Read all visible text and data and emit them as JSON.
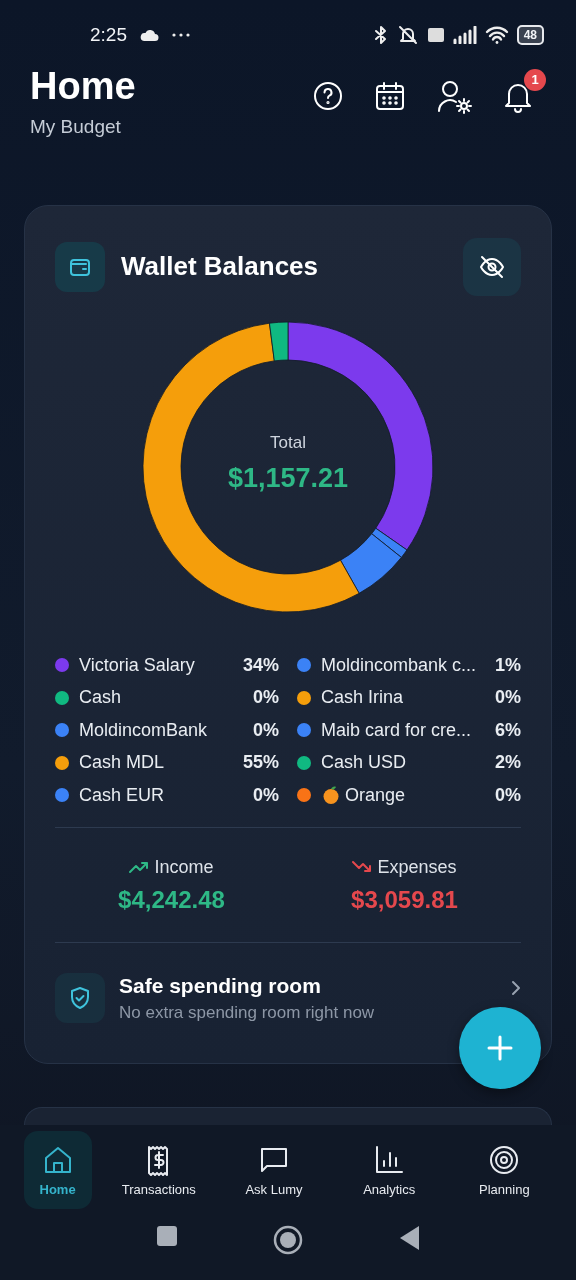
{
  "status_bar": {
    "time": "2:25",
    "battery": "48"
  },
  "header": {
    "title": "Home",
    "subtitle": "My Budget",
    "notification_count": "1"
  },
  "wallet_card": {
    "title": "Wallet Balances",
    "total_label": "Total",
    "total_value": "$1,157.21",
    "chart_data": {
      "type": "donut",
      "categories": [
        "Victoria Salary",
        "Moldincombank c...",
        "Cash",
        "Cash Irina",
        "MoldincomBank",
        "Maib card for cre...",
        "Cash MDL",
        "Cash USD",
        "Cash EUR",
        "Orange"
      ],
      "values": [
        34,
        1,
        0,
        0,
        0,
        6,
        55,
        2,
        0,
        0
      ],
      "value_labels": [
        "34%",
        "1%",
        "0%",
        "0%",
        "0%",
        "6%",
        "55%",
        "2%",
        "0%",
        "0%"
      ],
      "legend": "bottom"
    },
    "legend": [
      {
        "color": "#7c3aed",
        "fruit_icon": false
      },
      {
        "color": "#3b82f6",
        "fruit_icon": false
      },
      {
        "color": "#10b981",
        "fruit_icon": false
      },
      {
        "color": "#f59e0b",
        "fruit_icon": false
      },
      {
        "color": "#3b82f6",
        "fruit_icon": false
      },
      {
        "color": "#3b82f6",
        "fruit_icon": false
      },
      {
        "color": "#f59e0b",
        "fruit_icon": false
      },
      {
        "color": "#10b981",
        "fruit_icon": false
      },
      {
        "color": "#3b82f6",
        "fruit_icon": false
      },
      {
        "color": "#f97316",
        "fruit_icon": true
      }
    ],
    "income": {
      "label": "Income",
      "value": "$4,242.48"
    },
    "expenses": {
      "label": "Expenses",
      "value": "$3,059.81"
    },
    "safe_spending": {
      "title": "Safe spending room",
      "subtitle": "No extra spending room right now"
    }
  },
  "nav": [
    {
      "label": "Home",
      "selected": true
    },
    {
      "label": "Transactions",
      "selected": false
    },
    {
      "label": "Ask Lumy",
      "selected": false
    },
    {
      "label": "Analytics",
      "selected": false
    },
    {
      "label": "Planning",
      "selected": false
    }
  ]
}
